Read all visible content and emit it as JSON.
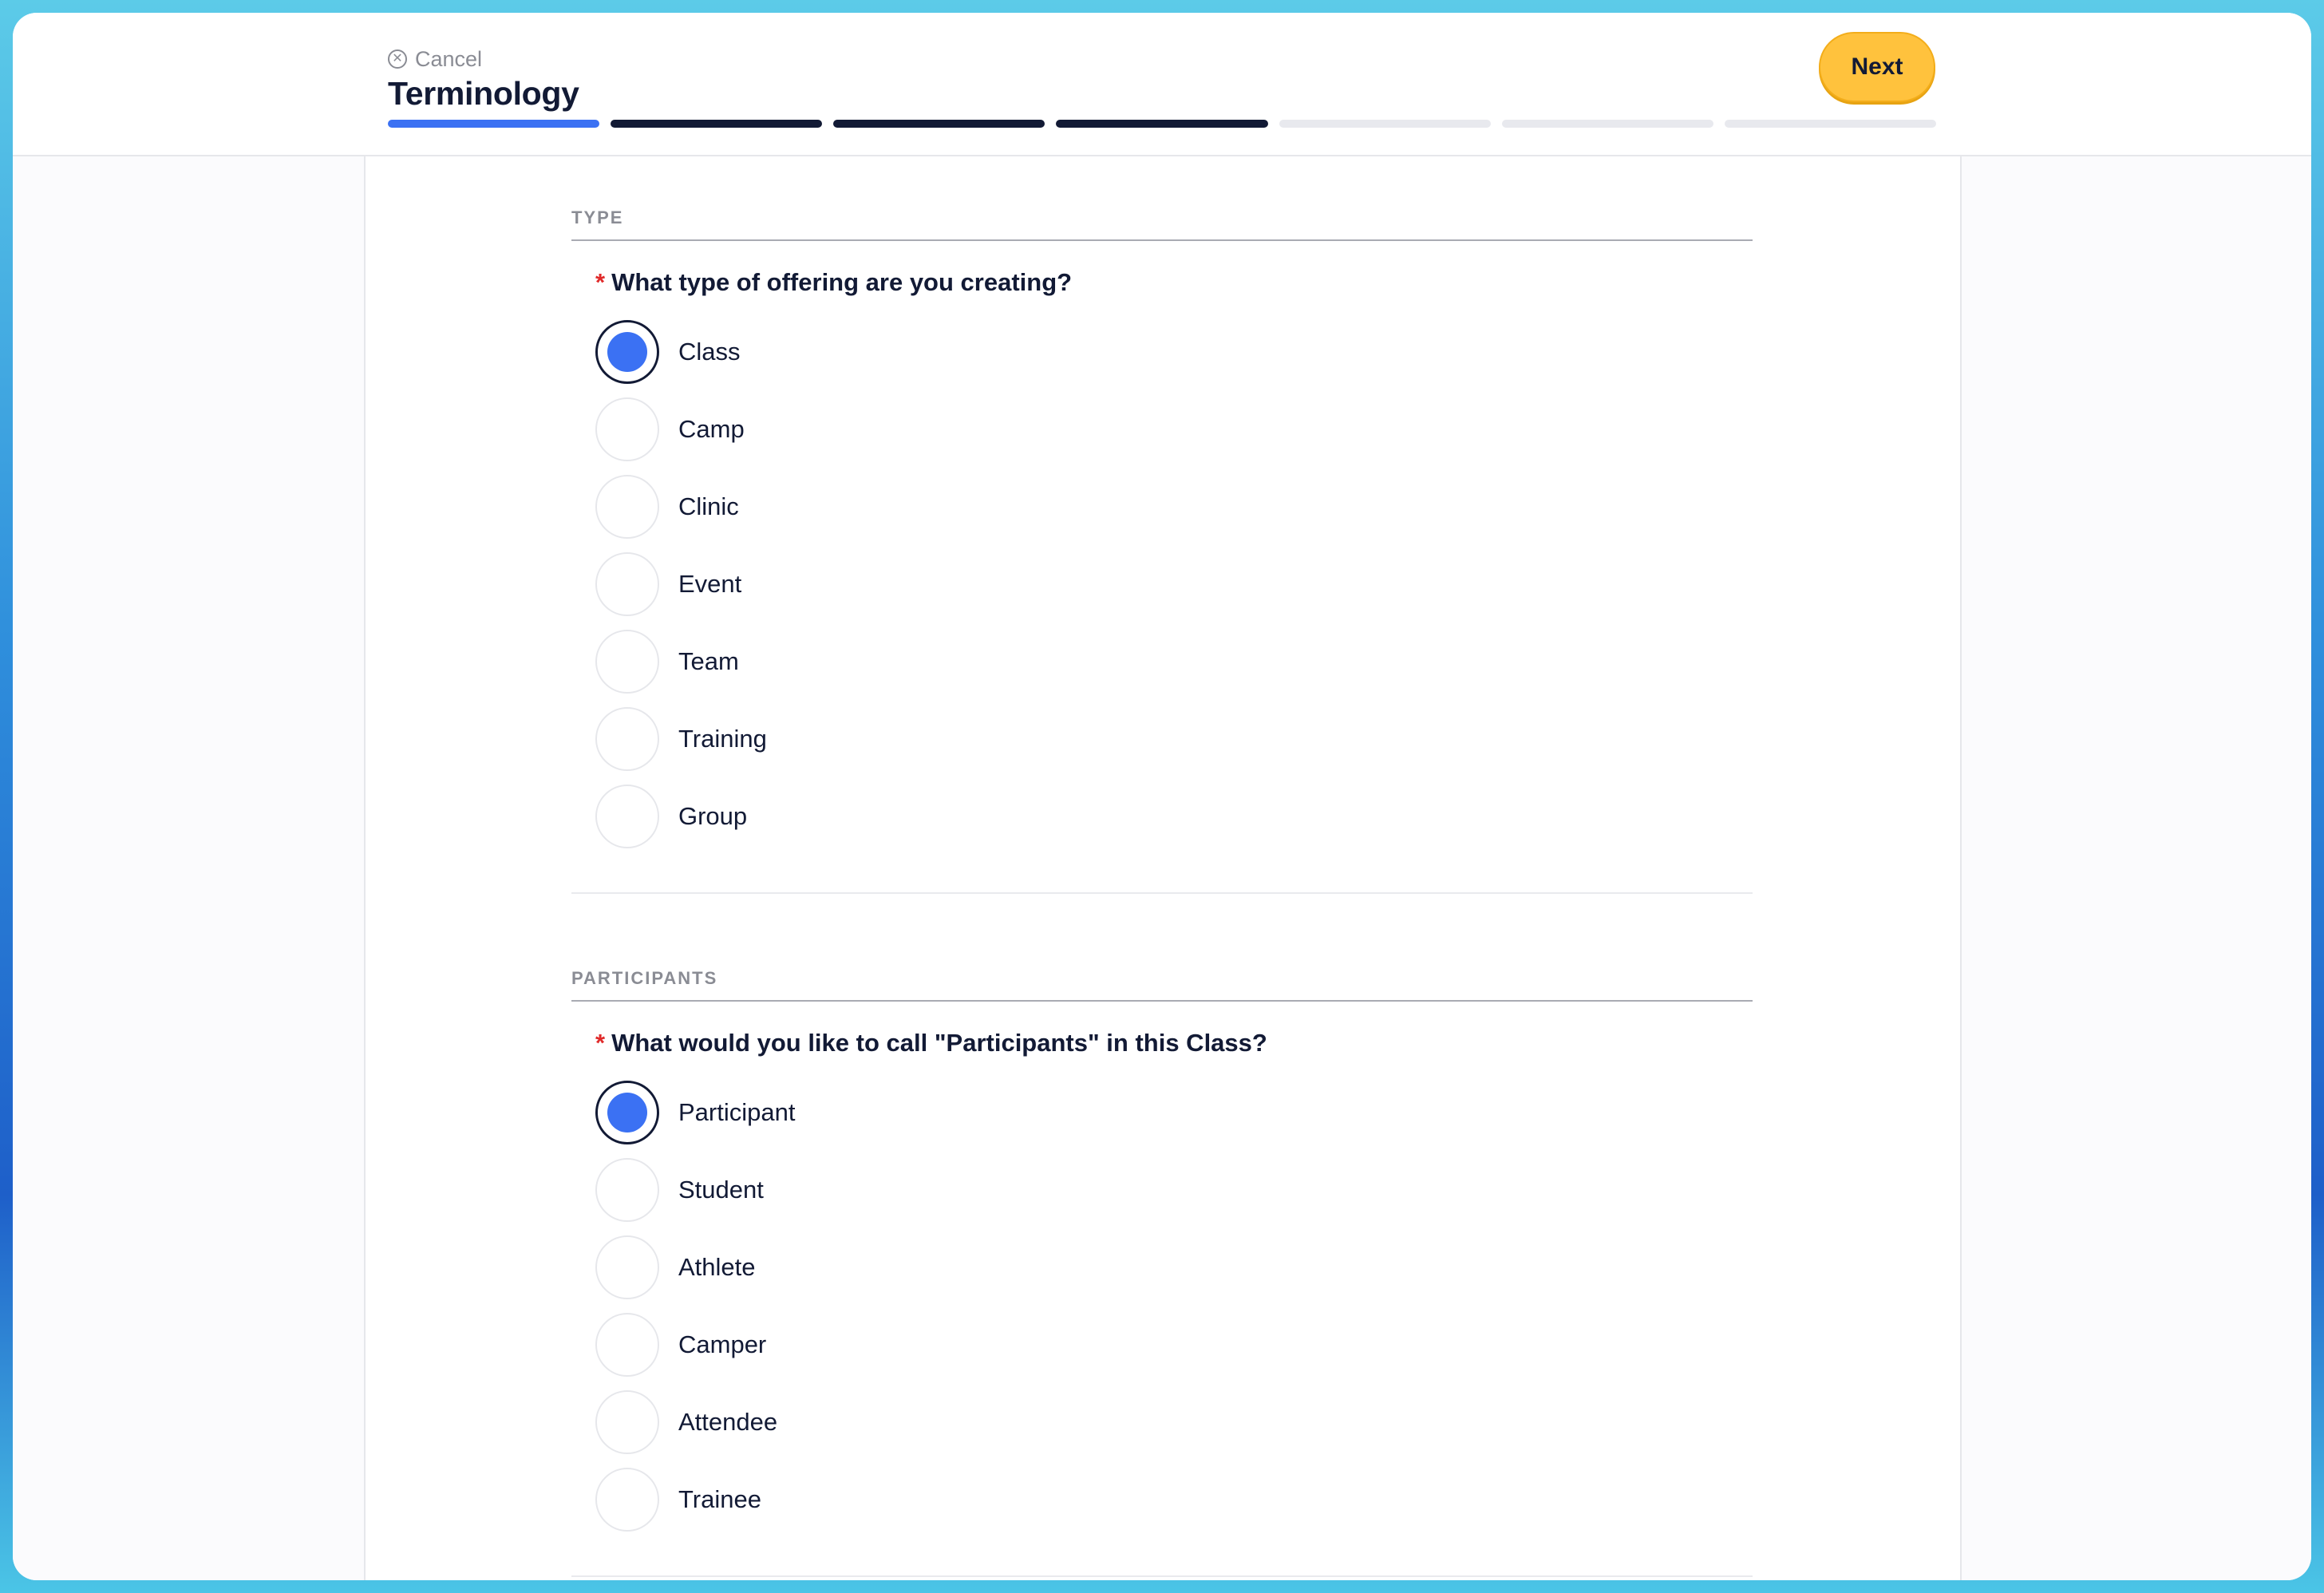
{
  "header": {
    "cancel_label": "Cancel",
    "title": "Terminology",
    "next_label": "Next",
    "progress": {
      "total_steps": 7,
      "current_step": 1,
      "completed_steps": 3
    }
  },
  "sections": [
    {
      "label": "TYPE",
      "required_marker": "*",
      "question": "What type of offering are you creating?",
      "selected": "Class",
      "options": [
        "Class",
        "Camp",
        "Clinic",
        "Event",
        "Team",
        "Training",
        "Group"
      ]
    },
    {
      "label": "PARTICIPANTS",
      "required_marker": "*",
      "question": "What would you like to call \"Participants\" in this Class?",
      "selected": "Participant",
      "options": [
        "Participant",
        "Student",
        "Athlete",
        "Camper",
        "Attendee",
        "Trainee"
      ]
    }
  ],
  "colors": {
    "accent": "#3b71f3",
    "navy": "#121a35",
    "next_button": "#ffc23d",
    "required": "#e02a2a"
  },
  "icons": {
    "cancel": "close-circle-icon"
  }
}
